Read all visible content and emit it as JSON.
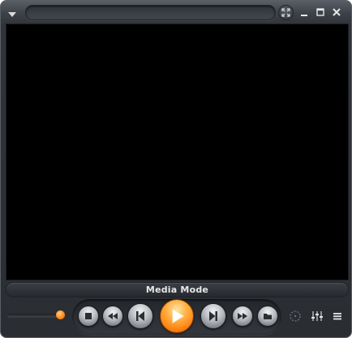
{
  "window": {
    "title": "",
    "buttons": [
      "fullscreen-icon",
      "minimize-icon",
      "maximize-icon",
      "close-icon"
    ]
  },
  "status": {
    "text": "Media Mode"
  },
  "volume": {
    "level": 0.92
  },
  "controls": {
    "buttons": [
      "stop-icon",
      "rewind-icon",
      "previous-icon",
      "play-icon",
      "next-icon",
      "fast-forward-icon",
      "open-folder-icon"
    ],
    "extra": [
      "reticle-icon",
      "equalizer-icon",
      "playlist-icon"
    ]
  },
  "colors": {
    "accent": "#ff8a1a",
    "frame": "#2a2d32",
    "video": "#000000"
  }
}
